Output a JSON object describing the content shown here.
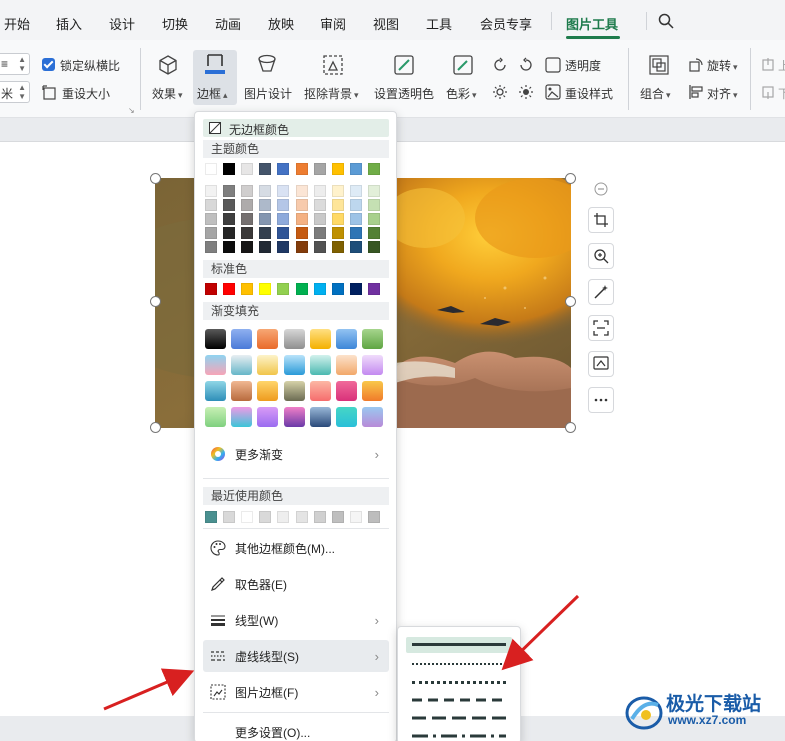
{
  "menu_tabs": [
    {
      "label": "开始"
    },
    {
      "label": "插入"
    },
    {
      "label": "设计"
    },
    {
      "label": "切换"
    },
    {
      "label": "动画"
    },
    {
      "label": "放映"
    },
    {
      "label": "审阅"
    },
    {
      "label": "视图"
    },
    {
      "label": "工具"
    },
    {
      "label": "会员专享"
    },
    {
      "label": "图片工具",
      "active": true
    }
  ],
  "ribbon": {
    "lock_ratio": "锁定纵横比",
    "lock_ratio_checked": true,
    "reset_size": "重设大小",
    "effects": "效果",
    "border": "边框",
    "picture_design": "图片设计",
    "remove_bg": "抠除背景",
    "set_transparent": "设置透明色",
    "color": "色彩",
    "transparency": "透明度",
    "reset_style": "重设样式",
    "group": "组合",
    "rotate": "旋转",
    "align": "对齐",
    "spin_top": "≡",
    "spin_bottom": "米",
    "up_partial": "上",
    "down_partial": "下"
  },
  "border_menu": {
    "no_border": "无边框颜色",
    "theme_colors_title": "主题颜色",
    "theme_top_row": [
      "#ffffff",
      "#000000",
      "#e7e6e6",
      "#44546a",
      "#4472c4",
      "#ed7d31",
      "#a5a5a5",
      "#ffc000",
      "#5b9bd5",
      "#70ad47"
    ],
    "theme_shades": [
      [
        "#f2f2f2",
        "#7f7f7f",
        "#d0cece",
        "#d6dce4",
        "#d9e2f3",
        "#fbe5d5",
        "#ededed",
        "#fff2cc",
        "#deebf6",
        "#e2efd9"
      ],
      [
        "#d8d8d8",
        "#595959",
        "#aeabab",
        "#adb9ca",
        "#b4c6e7",
        "#f7caac",
        "#dbdbdb",
        "#fee599",
        "#bdd7ee",
        "#c5e0b3"
      ],
      [
        "#bfbfbf",
        "#3f3f3f",
        "#757070",
        "#8496b0",
        "#8eaadb",
        "#f4b183",
        "#c9c9c9",
        "#ffd965",
        "#9dc3e6",
        "#a8d08d"
      ],
      [
        "#a5a5a5",
        "#262626",
        "#3a3838",
        "#323f4f",
        "#2f5496",
        "#c55a11",
        "#7b7b7b",
        "#bf9000",
        "#2e75b5",
        "#538135"
      ],
      [
        "#7f7f7f",
        "#0c0c0c",
        "#171616",
        "#222a35",
        "#1f3864",
        "#833c0b",
        "#525252",
        "#7f6000",
        "#1e4e79",
        "#375623"
      ]
    ],
    "standard_colors_title": "标准色",
    "standard_colors": [
      "#c00000",
      "#ff0000",
      "#ffc000",
      "#ffff00",
      "#92d050",
      "#00b050",
      "#00b0f0",
      "#0070c0",
      "#002060",
      "#7030a0"
    ],
    "gradient_title": "渐变填充",
    "gradients": [
      [
        "#000000",
        "#5a5a5a"
      ],
      [
        "#4a7ad8",
        "#8fb0f0"
      ],
      [
        "#e96a2a",
        "#f7a774"
      ],
      [
        "#8f8f8f",
        "#d7d7d7"
      ],
      [
        "#f4b000",
        "#ffe083"
      ],
      [
        "#3d86d8",
        "#93c3f2"
      ],
      [
        "#5fa543",
        "#a6d58d"
      ],
      [
        "#f7a4b7",
        "#8fd3f0"
      ],
      [
        "#66b6c8",
        "#e8eef2"
      ],
      [
        "#f1c54a",
        "#fdf3c9"
      ],
      [
        "#2a9ad8",
        "#b9e3fa"
      ],
      [
        "#4bb9b0",
        "#d2f1ec"
      ],
      [
        "#f2a86a",
        "#fce2cc"
      ],
      [
        "#c38af0",
        "#f0dcfb"
      ],
      [
        "#2e8eb8",
        "#8fd6e6"
      ],
      [
        "#b86a3d",
        "#f0b892"
      ],
      [
        "#ee9b1e",
        "#ffd56b"
      ],
      [
        "#6b6b52",
        "#d6d2a8"
      ],
      [
        "#f66d6d",
        "#fcb7a4"
      ],
      [
        "#d9317a",
        "#f06a9a"
      ],
      [
        "#f07b2a",
        "#f9c84a"
      ],
      [
        "#7fd07f",
        "#c8f0b4"
      ],
      [
        "#3bc6d8",
        "#f09ae6"
      ],
      [
        "#9a6cf0",
        "#d99bf6"
      ],
      [
        "#6a3aa8",
        "#f07fc8"
      ],
      [
        "#2a4a7a",
        "#9ab8d8"
      ],
      [
        "#2abfd8",
        "#46d6c6"
      ],
      [
        "#b88ad8",
        "#9ac8f0"
      ]
    ],
    "more_gradient": "更多渐变",
    "recent_title": "最近使用颜色",
    "recent_colors": [
      "#4a9090",
      "#d9d9d9",
      "#ffffff",
      "#d9d9d9",
      "#eeeeee",
      "#e4e4e4",
      "#d0d0d0",
      "#bfbfbf",
      "#f5f5f5",
      "#bdbdbd"
    ],
    "other_color": "其他边框颜色(M)...",
    "eyedropper": "取色器(E)",
    "line_style": "线型(W)",
    "dash_style": "虚线线型(S)",
    "picture_border": "图片边框(F)",
    "more_settings": "更多设置(O)..."
  },
  "dash_options": [
    {
      "style": "solid",
      "selected": true
    },
    {
      "style": "dotted-small"
    },
    {
      "style": "dotted-square"
    },
    {
      "style": "dash"
    },
    {
      "style": "long-dash"
    },
    {
      "style": "dash-dot"
    }
  ],
  "watermark": {
    "brand": "极光下载站",
    "url": "www.xz7.com"
  }
}
